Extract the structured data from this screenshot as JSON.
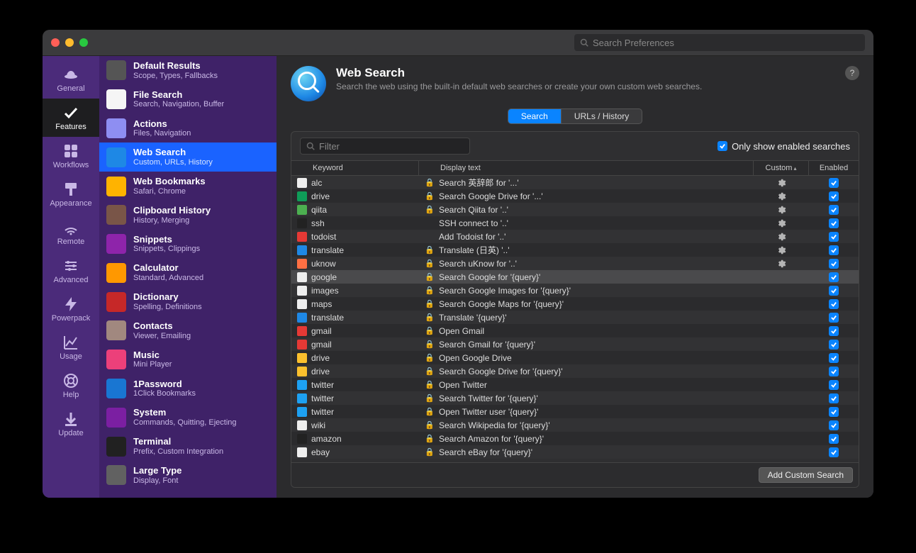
{
  "titlebar": {
    "search_placeholder": "Search Preferences"
  },
  "leftbar": [
    {
      "label": "General",
      "icon": "hat"
    },
    {
      "label": "Features",
      "icon": "check",
      "active": true
    },
    {
      "label": "Workflows",
      "icon": "grid"
    },
    {
      "label": "Appearance",
      "icon": "brush"
    },
    {
      "label": "Remote",
      "icon": "remote"
    },
    {
      "label": "Advanced",
      "icon": "sliders"
    },
    {
      "label": "Powerpack",
      "icon": "bolt"
    },
    {
      "label": "Usage",
      "icon": "chart"
    },
    {
      "label": "Help",
      "icon": "lifebuoy"
    },
    {
      "label": "Update",
      "icon": "download"
    }
  ],
  "features": [
    {
      "title": "Default Results",
      "sub": "Scope, Types, Fallbacks",
      "icon": "magnifier",
      "bg": "#555"
    },
    {
      "title": "File Search",
      "sub": "Search, Navigation, Buffer",
      "icon": "file",
      "bg": "#f5f5f5"
    },
    {
      "title": "Actions",
      "sub": "Files, Navigation",
      "icon": "actions",
      "bg": "#8e8ef2"
    },
    {
      "title": "Web Search",
      "sub": "Custom, URLs, History",
      "icon": "globe",
      "bg": "#1e88e5",
      "selected": true
    },
    {
      "title": "Web Bookmarks",
      "sub": "Safari, Chrome",
      "icon": "bookmark",
      "bg": "#ffb300"
    },
    {
      "title": "Clipboard History",
      "sub": "History, Merging",
      "icon": "clipboard",
      "bg": "#795548"
    },
    {
      "title": "Snippets",
      "sub": "Snippets, Clippings",
      "icon": "snippet",
      "bg": "#8e24aa"
    },
    {
      "title": "Calculator",
      "sub": "Standard, Advanced",
      "icon": "calc",
      "bg": "#ff9800"
    },
    {
      "title": "Dictionary",
      "sub": "Spelling, Definitions",
      "icon": "dict",
      "bg": "#c62828"
    },
    {
      "title": "Contacts",
      "sub": "Viewer, Emailing",
      "icon": "contacts",
      "bg": "#a1887f"
    },
    {
      "title": "Music",
      "sub": "Mini Player",
      "icon": "music",
      "bg": "#ec407a"
    },
    {
      "title": "1Password",
      "sub": "1Click Bookmarks",
      "icon": "1p",
      "bg": "#1976d2"
    },
    {
      "title": "System",
      "sub": "Commands, Quitting, Ejecting",
      "icon": "power",
      "bg": "#7b1fa2"
    },
    {
      "title": "Terminal",
      "sub": "Prefix, Custom Integration",
      "icon": "terminal",
      "bg": "#212121"
    },
    {
      "title": "Large Type",
      "sub": "Display, Font",
      "icon": "L",
      "bg": "#616161"
    }
  ],
  "main": {
    "title": "Web Search",
    "subtitle": "Search the web using the built-in default web searches or create your own custom web searches.",
    "tabs": [
      "Search",
      "URLs / History"
    ],
    "active_tab": 0,
    "filter_placeholder": "Filter",
    "only_enabled_label": "Only show enabled searches",
    "only_enabled": true,
    "columns": {
      "keyword": "Keyword",
      "display": "Display text",
      "custom": "Custom",
      "enabled": "Enabled"
    },
    "footer_button": "Add Custom Search"
  },
  "rows": [
    {
      "keyword": "alc",
      "display": "Search 英辞郎 for '...'",
      "lock": true,
      "custom": true,
      "enabled": true,
      "fav": "f-white"
    },
    {
      "keyword": "drive",
      "display": "Search Google Drive for '...'",
      "lock": true,
      "custom": true,
      "enabled": true,
      "fav": "f-drive"
    },
    {
      "keyword": "qiita",
      "display": "Search Qiita for '..'",
      "lock": true,
      "custom": true,
      "enabled": true,
      "fav": "f-green"
    },
    {
      "keyword": "ssh",
      "display": "SSH connect to '..'",
      "lock": false,
      "custom": true,
      "enabled": true,
      "fav": "f-black"
    },
    {
      "keyword": "todoist",
      "display": "Add Todoist for '..'",
      "lock": false,
      "custom": true,
      "enabled": true,
      "fav": "f-red"
    },
    {
      "keyword": "translate",
      "display": "Translate (日英) '..'",
      "lock": true,
      "custom": true,
      "enabled": true,
      "fav": "f-blue"
    },
    {
      "keyword": "uknow",
      "display": "Search uKnow for '..'",
      "lock": true,
      "custom": true,
      "enabled": true,
      "fav": "f-orange"
    },
    {
      "keyword": "google",
      "display": "Search Google for '{query}'",
      "lock": true,
      "custom": false,
      "enabled": true,
      "fav": "f-white",
      "highlight": true
    },
    {
      "keyword": "images",
      "display": "Search Google Images for '{query}'",
      "lock": true,
      "custom": false,
      "enabled": true,
      "fav": "f-white"
    },
    {
      "keyword": "maps",
      "display": "Search Google Maps for '{query}'",
      "lock": true,
      "custom": false,
      "enabled": true,
      "fav": "f-white"
    },
    {
      "keyword": "translate",
      "display": "Translate '{query}'",
      "lock": true,
      "custom": false,
      "enabled": true,
      "fav": "f-blue"
    },
    {
      "keyword": "gmail",
      "display": "Open Gmail",
      "lock": true,
      "custom": false,
      "enabled": true,
      "fav": "f-red"
    },
    {
      "keyword": "gmail",
      "display": "Search Gmail for '{query}'",
      "lock": true,
      "custom": false,
      "enabled": true,
      "fav": "f-red"
    },
    {
      "keyword": "drive",
      "display": "Open Google Drive",
      "lock": true,
      "custom": false,
      "enabled": true,
      "fav": "f-yellow"
    },
    {
      "keyword": "drive",
      "display": "Search Google Drive for '{query}'",
      "lock": true,
      "custom": false,
      "enabled": true,
      "fav": "f-yellow"
    },
    {
      "keyword": "twitter",
      "display": "Open Twitter",
      "lock": true,
      "custom": false,
      "enabled": true,
      "fav": "f-twitter"
    },
    {
      "keyword": "twitter",
      "display": "Search Twitter for '{query}'",
      "lock": true,
      "custom": false,
      "enabled": true,
      "fav": "f-twitter"
    },
    {
      "keyword": "twitter",
      "display": "Open Twitter user '{query}'",
      "lock": true,
      "custom": false,
      "enabled": true,
      "fav": "f-twitter"
    },
    {
      "keyword": "wiki",
      "display": "Search Wikipedia for '{query}'",
      "lock": true,
      "custom": false,
      "enabled": true,
      "fav": "f-white"
    },
    {
      "keyword": "amazon",
      "display": "Search Amazon for '{query}'",
      "lock": true,
      "custom": false,
      "enabled": true,
      "fav": "f-black"
    },
    {
      "keyword": "ebay",
      "display": "Search eBay for '{query}'",
      "lock": true,
      "custom": false,
      "enabled": true,
      "fav": "f-white"
    }
  ]
}
